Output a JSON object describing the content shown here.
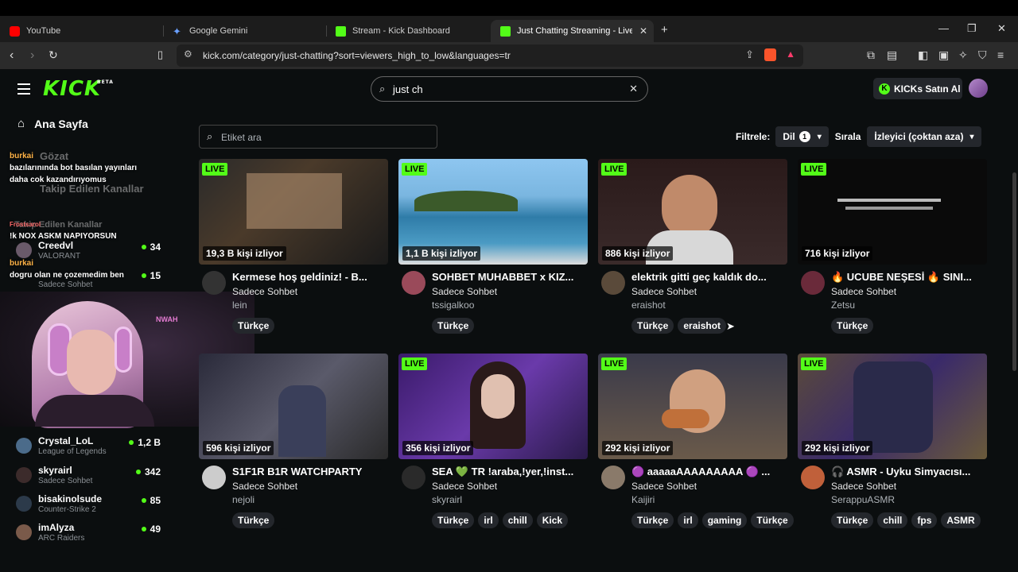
{
  "browser": {
    "tabs": [
      {
        "label": "YouTube",
        "icon": "youtube-icon"
      },
      {
        "label": "Google Gemini",
        "icon": "gemini-icon"
      },
      {
        "label": "Stream - Kick Dashboard",
        "icon": "kick-icon"
      },
      {
        "label": "Just Chatting Streaming - Live St",
        "icon": "kick-icon"
      }
    ],
    "url": "kick.com/category/just-chatting?sort=viewers_high_to_low&languages=tr"
  },
  "header": {
    "logo": "KICK",
    "logo_sup": "BETA",
    "search_value": "just ch",
    "kicks_button": "KICKs Satın Al"
  },
  "sidebar": {
    "home": "Ana Sayfa",
    "browse": "Gözat",
    "following": "Takip Edilen Kanallar",
    "following_small": "Takip Edilen Kanallar",
    "items": [
      {
        "name": "Creedvl",
        "category": "VALORANT",
        "viewers": "34"
      },
      {
        "name": "",
        "category": "Sadece Sohbet",
        "viewers": "15"
      },
      {
        "name": "Crystal_LoL",
        "category": "League of Legends",
        "viewers": "1,2 B"
      },
      {
        "name": "skyrairl",
        "category": "Sadece Sohbet",
        "viewers": "342"
      },
      {
        "name": "bisakinolsude",
        "category": "Counter-Strike 2",
        "viewers": "85"
      },
      {
        "name": "imAlyza",
        "category": "ARC Raiders",
        "viewers": "49"
      }
    ]
  },
  "overlay": {
    "chat": [
      {
        "user": "burkai",
        "text": "bazılarınında bot basılan yayınları daha cok kazandırıyomus"
      },
      {
        "user": "Frostsarol",
        "text": "!k NOX ASKM NAPIYORSUN"
      },
      {
        "user": "burkai",
        "text": "dogru olan ne çozemedim ben"
      }
    ],
    "neon": "NWAH"
  },
  "filters": {
    "tag_placeholder": "Etiket ara",
    "filter_label": "Filtrele:",
    "lang_label": "Dil",
    "lang_count": "1",
    "sort_label": "Sırala",
    "sort_value": "İzleyici (çoktan aza)"
  },
  "cards": [
    {
      "live": "LIVE",
      "viewers": "19,3 B kişi izliyor",
      "title": "Kermese hoş geldiniz! - B...",
      "category": "Sadece Sohbet",
      "channel": "lein",
      "tags": [
        "Türkçe"
      ]
    },
    {
      "live": "LIVE",
      "viewers": "1,1 B kişi izliyor",
      "title": "SOHBET MUHABBET x KIZ...",
      "category": "Sadece Sohbet",
      "channel": "tssigalkoo",
      "tags": [
        "Türkçe"
      ]
    },
    {
      "live": "LIVE",
      "viewers": "886 kişi izliyor",
      "title": "elektrik gitti geç kaldık do...",
      "category": "Sadece Sohbet",
      "channel": "eraishot",
      "tags": [
        "Türkçe",
        "eraishot"
      ]
    },
    {
      "live": "LIVE",
      "viewers": "716 kişi izliyor",
      "title": "🔥 UCUBE NEŞESİ 🔥 SINI...",
      "category": "Sadece Sohbet",
      "channel": "Zetsu",
      "tags": [
        "Türkçe"
      ]
    },
    {
      "live": "",
      "viewers": "596 kişi izliyor",
      "title": "S1F1R B1R WATCHPARTY",
      "category": "Sadece Sohbet",
      "channel": "nejoli",
      "tags": [
        "Türkçe"
      ]
    },
    {
      "live": "LIVE",
      "viewers": "356 kişi izliyor",
      "title": "SEA 💚 TR !araba,!yer,!inst...",
      "category": "Sadece Sohbet",
      "channel": "skyrairl",
      "tags": [
        "Türkçe",
        "irl",
        "chill",
        "Kick"
      ]
    },
    {
      "live": "LIVE",
      "viewers": "292 kişi izliyor",
      "title": "🟣 aaaaaAAAAAAAAA 🟣 ...",
      "category": "Sadece Sohbet",
      "channel": "Kaijiri",
      "tags": [
        "Türkçe",
        "irl",
        "gaming",
        "Türkçe"
      ]
    },
    {
      "live": "LIVE",
      "viewers": "292 kişi izliyor",
      "title": "🎧 ASMR - Uyku Simyacısı...",
      "category": "Sadece Sohbet",
      "channel": "SerappuASMR",
      "tags": [
        "Türkçe",
        "chill",
        "fps",
        "ASMR"
      ]
    }
  ],
  "colors": {
    "accent": "#53fc18",
    "bg": "#0b0e0f",
    "pill": "#24272c"
  }
}
